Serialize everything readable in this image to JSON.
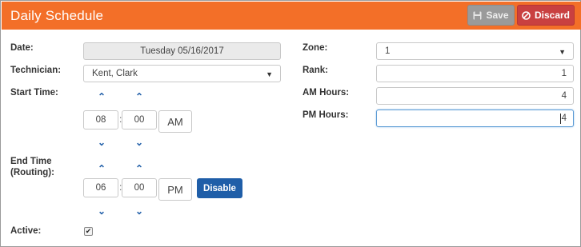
{
  "header": {
    "title": "Daily Schedule",
    "save_label": "Save",
    "discard_label": "Discard"
  },
  "form": {
    "date": {
      "label": "Date:",
      "value": "Tuesday 05/16/2017"
    },
    "technician": {
      "label": "Technician:",
      "value": "Kent, Clark"
    },
    "start_time": {
      "label": "Start Time:",
      "hour": "08",
      "minute": "00",
      "meridiem": "AM"
    },
    "end_time": {
      "label_line1": "End Time",
      "label_line2": "(Routing):",
      "hour": "06",
      "minute": "00",
      "meridiem": "PM",
      "disable_label": "Disable"
    },
    "active": {
      "label": "Active:",
      "checked": true
    },
    "zone": {
      "label": "Zone:",
      "value": "1"
    },
    "rank": {
      "label": "Rank:",
      "value": "1"
    },
    "am_hours": {
      "label": "AM Hours:",
      "value": "4"
    },
    "pm_hours": {
      "label": "PM Hours:",
      "value": "4"
    }
  },
  "icons": {
    "save": "floppy-disk-icon",
    "discard": "ban-icon",
    "up": "chevron-up-icon",
    "down": "chevron-down-icon",
    "dropdown": "caret-down-icon",
    "check": "checkmark-icon"
  },
  "colors": {
    "header": "#f36f28",
    "discard": "#c94040",
    "save_disabled": "#9a9a9a",
    "primary": "#1f5ea8"
  }
}
